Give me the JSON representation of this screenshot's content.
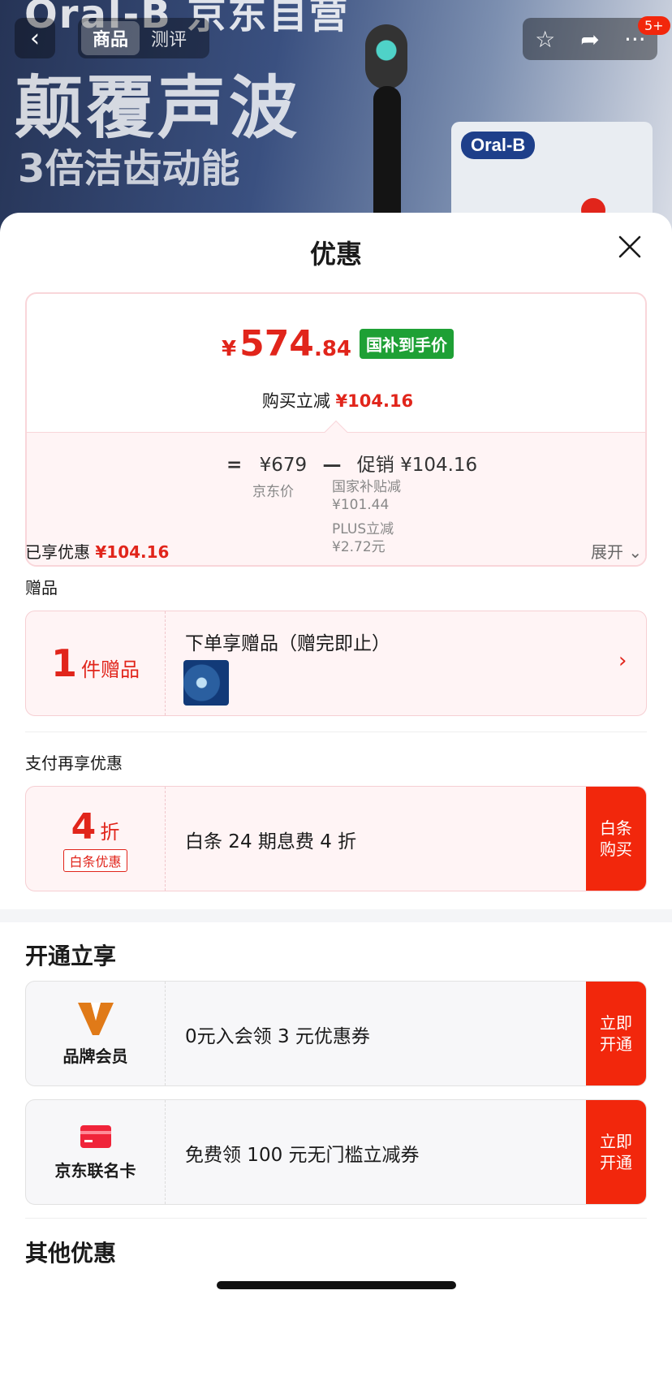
{
  "banner": {
    "brand_top": "Oral-B 京东自营",
    "headline": "颠覆声波",
    "subline": "3倍洁齿动能",
    "box_logo": "Oral-B"
  },
  "nav": {
    "tabs": [
      {
        "label": "商品"
      },
      {
        "label": "测评"
      }
    ],
    "badge": "5+"
  },
  "sheet": {
    "title": "优惠",
    "price": {
      "yen": "¥",
      "main": "574",
      "decimal": ".84",
      "tag": "国补到手价",
      "sub_label": "购买立减",
      "sub_value": "¥104.16"
    },
    "formula": {
      "eq": "=",
      "jd_price": "¥679",
      "minus": "—",
      "promo_label": "促销",
      "promo_value": "¥104.16",
      "jd_price_label": "京东价",
      "details": [
        {
          "label": "国家补贴减",
          "value": "¥101.44"
        },
        {
          "label": "PLUS立减",
          "value": "¥2.72元"
        }
      ]
    },
    "enjoyed_label": "已享优惠",
    "enjoyed_value": "¥104.16",
    "expand_label": "展开",
    "gift_section": "赠品",
    "gift": {
      "count": "1",
      "unit": "件赠品",
      "text": "下单享赠品（赠完即止）"
    },
    "pay_section": "支付再享优惠",
    "pay": {
      "discount": "4",
      "unit": "折",
      "badge": "白条优惠",
      "text": "白条 24 期息费 4 折",
      "button": "白条购买"
    },
    "open_title": "开通立享",
    "offers": [
      {
        "label": "品牌会员",
        "text": "0元入会领 3 元优惠券",
        "button": "立即开通"
      },
      {
        "label": "京东联名卡",
        "text": "免费领 100 元无门槛立减券",
        "button": "立即开通"
      }
    ],
    "other_title": "其他优惠"
  },
  "colors": {
    "accent_red": "#e1251b",
    "button_red": "#f2270c",
    "subsidy_green": "#1ea035"
  }
}
